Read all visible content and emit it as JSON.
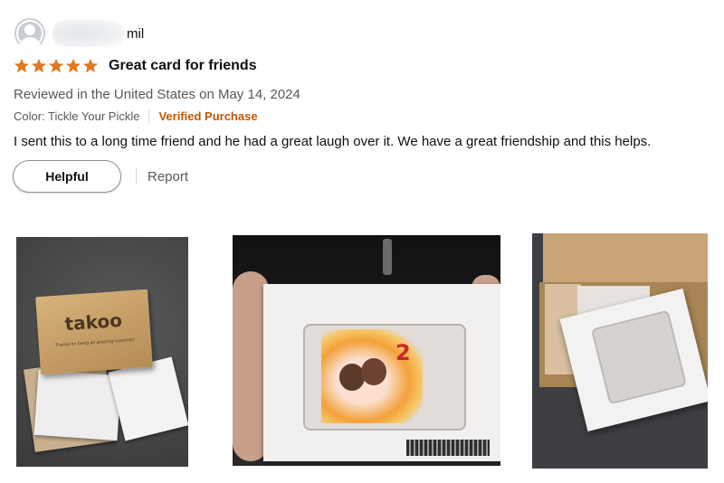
{
  "review": {
    "reviewer": {
      "name_visible": "mil",
      "avatar_icon": "default-user-avatar-icon"
    },
    "rating": {
      "stars": 5,
      "max": 5,
      "color": "#de7921"
    },
    "title": "Great card for friends",
    "reviewed_line": "Reviewed in the United States on May 14, 2024",
    "variant": "Color: Tickle Your Pickle",
    "verified": "Verified Purchase",
    "body": "I sent this to a long time friend and he had a great laugh over it. We have a great friendship and this helps.",
    "actions": {
      "helpful": "Helpful",
      "report": "Report"
    },
    "photos": [
      {
        "box_text": "takoo",
        "box_subtext": "Thanks for being an amazing customer!"
      },
      {
        "card_number": "2"
      },
      {}
    ]
  },
  "colors": {
    "accent": "#c45500",
    "text": "#0f1111",
    "secondary": "#565959",
    "star": "#de7921"
  }
}
